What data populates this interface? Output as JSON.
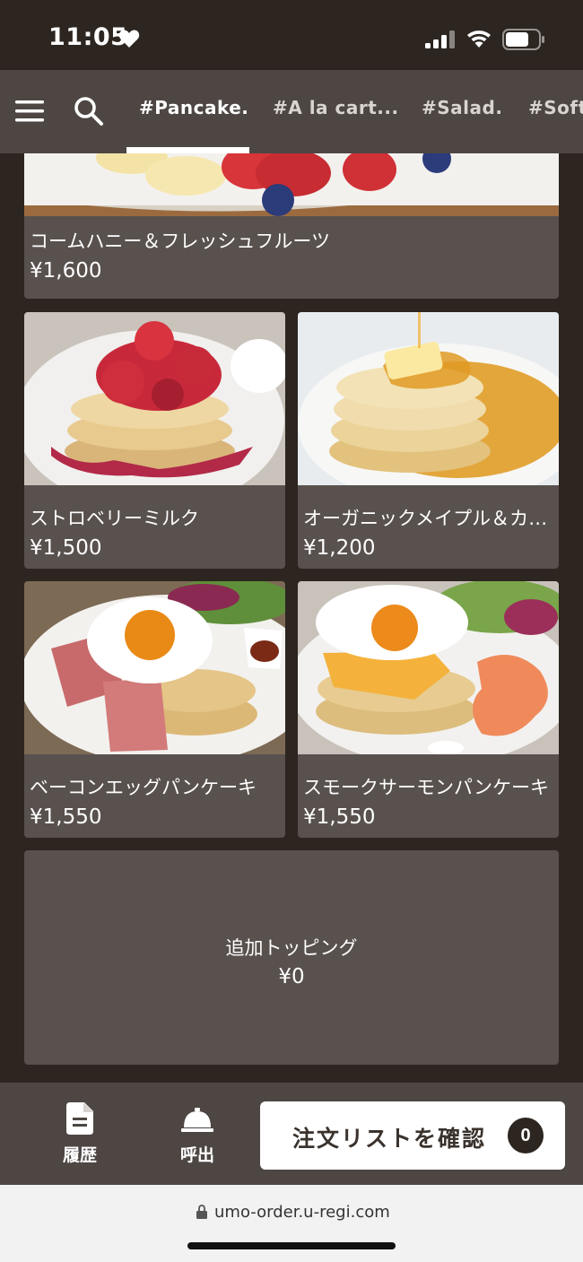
{
  "status_bar": {
    "time": "11:05",
    "icons": [
      "heart-icon",
      "signal-icon",
      "wifi-icon",
      "battery-icon"
    ]
  },
  "nav": {
    "tabs": [
      {
        "label": "#Pancake.",
        "active": true
      },
      {
        "label": "#A la cart...",
        "active": false
      },
      {
        "label": "#Salad.",
        "active": false
      },
      {
        "label": "#Soft",
        "active": false
      }
    ]
  },
  "menu": {
    "items": [
      {
        "name": "コームハニー＆フレッシュフルーツ",
        "price": "¥1,600"
      },
      {
        "name": "ストロベリーミルク",
        "price": "¥1,500"
      },
      {
        "name": "オーガニックメイプル＆カルピス...",
        "price": "¥1,200"
      },
      {
        "name": "ベーコンエッグパンケーキ",
        "price": "¥1,550"
      },
      {
        "name": "スモークサーモンパンケーキ",
        "price": "¥1,550"
      },
      {
        "name": "追加トッピング",
        "price": "¥0"
      }
    ]
  },
  "bottom_bar": {
    "history_label": "履歴",
    "call_label": "呼出",
    "order_button_label": "注文リストを確認",
    "order_count": "0"
  },
  "browser": {
    "url": "umo-order.u-regi.com"
  },
  "colors": {
    "background": "#2d2620",
    "nav_bg": "#4d4643",
    "card_bg": "#58514e",
    "accent": "#ffffff"
  }
}
